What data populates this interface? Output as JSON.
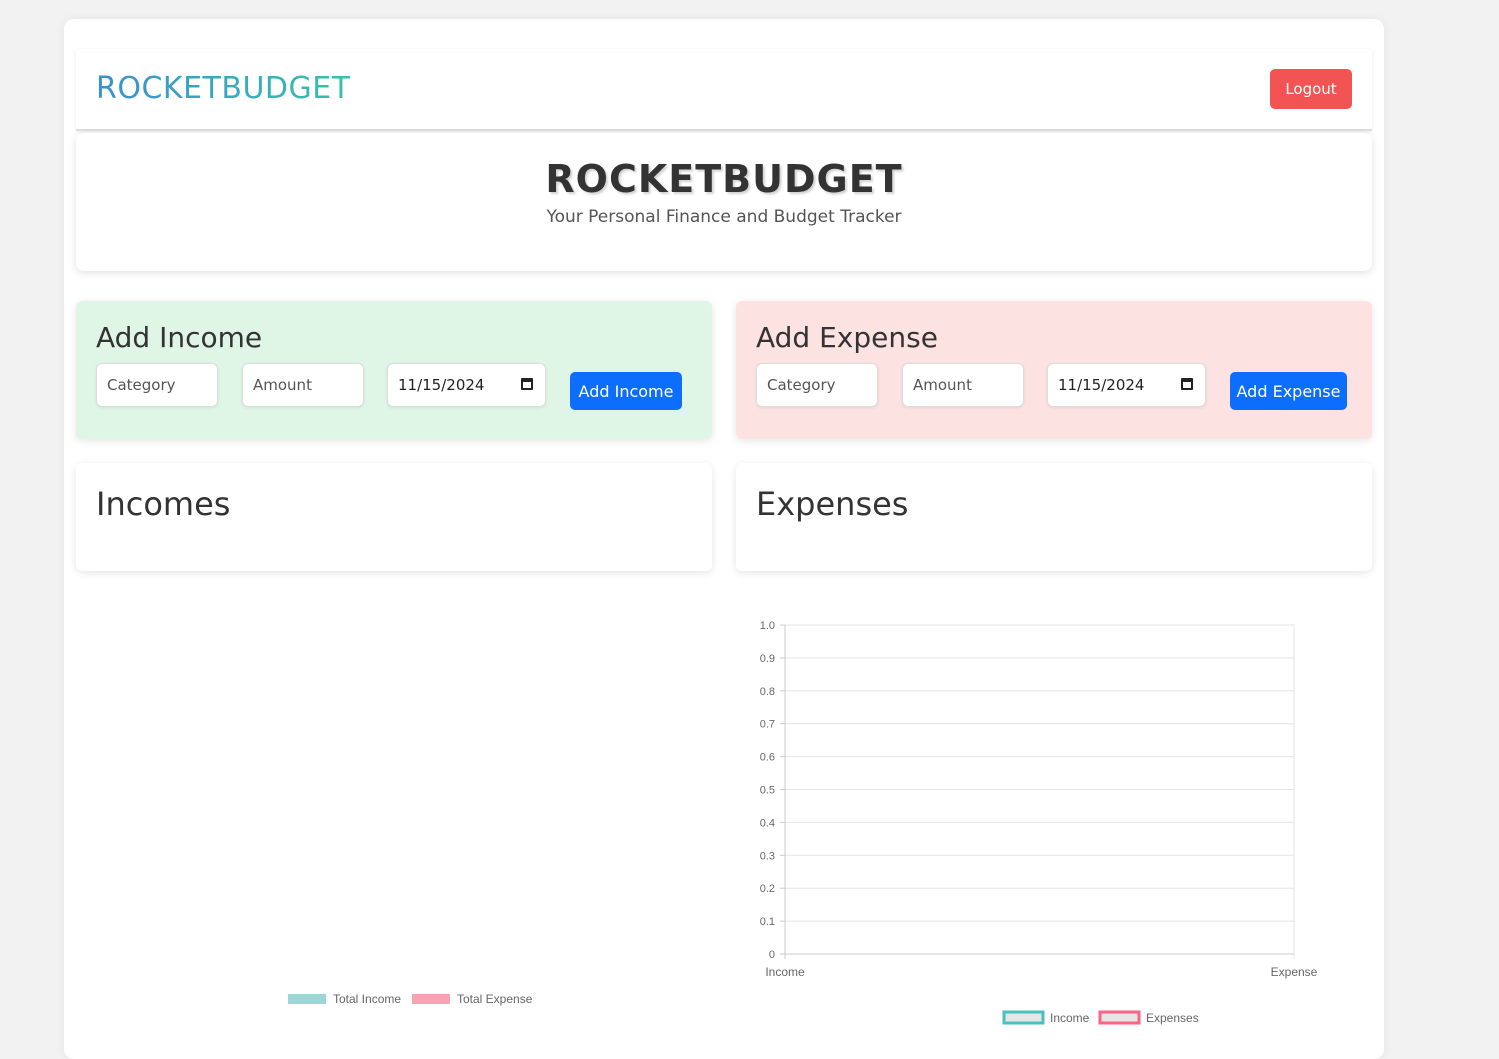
{
  "navbar": {
    "brand": "ROCKETBUDGET",
    "logout_label": "Logout"
  },
  "hero": {
    "title": "ROCKETBUDGET",
    "subtitle": "Your Personal Finance and Budget Tracker"
  },
  "add_income": {
    "title": "Add Income",
    "category_placeholder": "Category",
    "amount_placeholder": "Amount",
    "date_value": "11/15/2024",
    "button_label": "Add Income"
  },
  "add_expense": {
    "title": "Add Expense",
    "category_placeholder": "Category",
    "amount_placeholder": "Amount",
    "date_value": "11/15/2024",
    "button_label": "Add Expense"
  },
  "incomes": {
    "title": "Incomes"
  },
  "expenses": {
    "title": "Expenses"
  },
  "pie_legend": {
    "items": [
      {
        "label": "Total Income",
        "color": "#9ad8d8"
      },
      {
        "label": "Total Expense",
        "color": "#f7a3b4"
      }
    ]
  },
  "chart_data": {
    "type": "bar",
    "categories": [
      "Income",
      "Expense"
    ],
    "series": [
      {
        "name": "Income",
        "values": [
          0,
          0
        ],
        "color": "#4bc0c0"
      },
      {
        "name": "Expenses",
        "values": [
          0,
          0
        ],
        "color": "#ff6384"
      }
    ],
    "yticks": [
      "0",
      "0.1",
      "0.2",
      "0.3",
      "0.4",
      "0.5",
      "0.6",
      "0.7",
      "0.8",
      "0.9",
      "1.0"
    ],
    "ylim": [
      0,
      1
    ],
    "grid": true,
    "legend_position": "bottom"
  }
}
